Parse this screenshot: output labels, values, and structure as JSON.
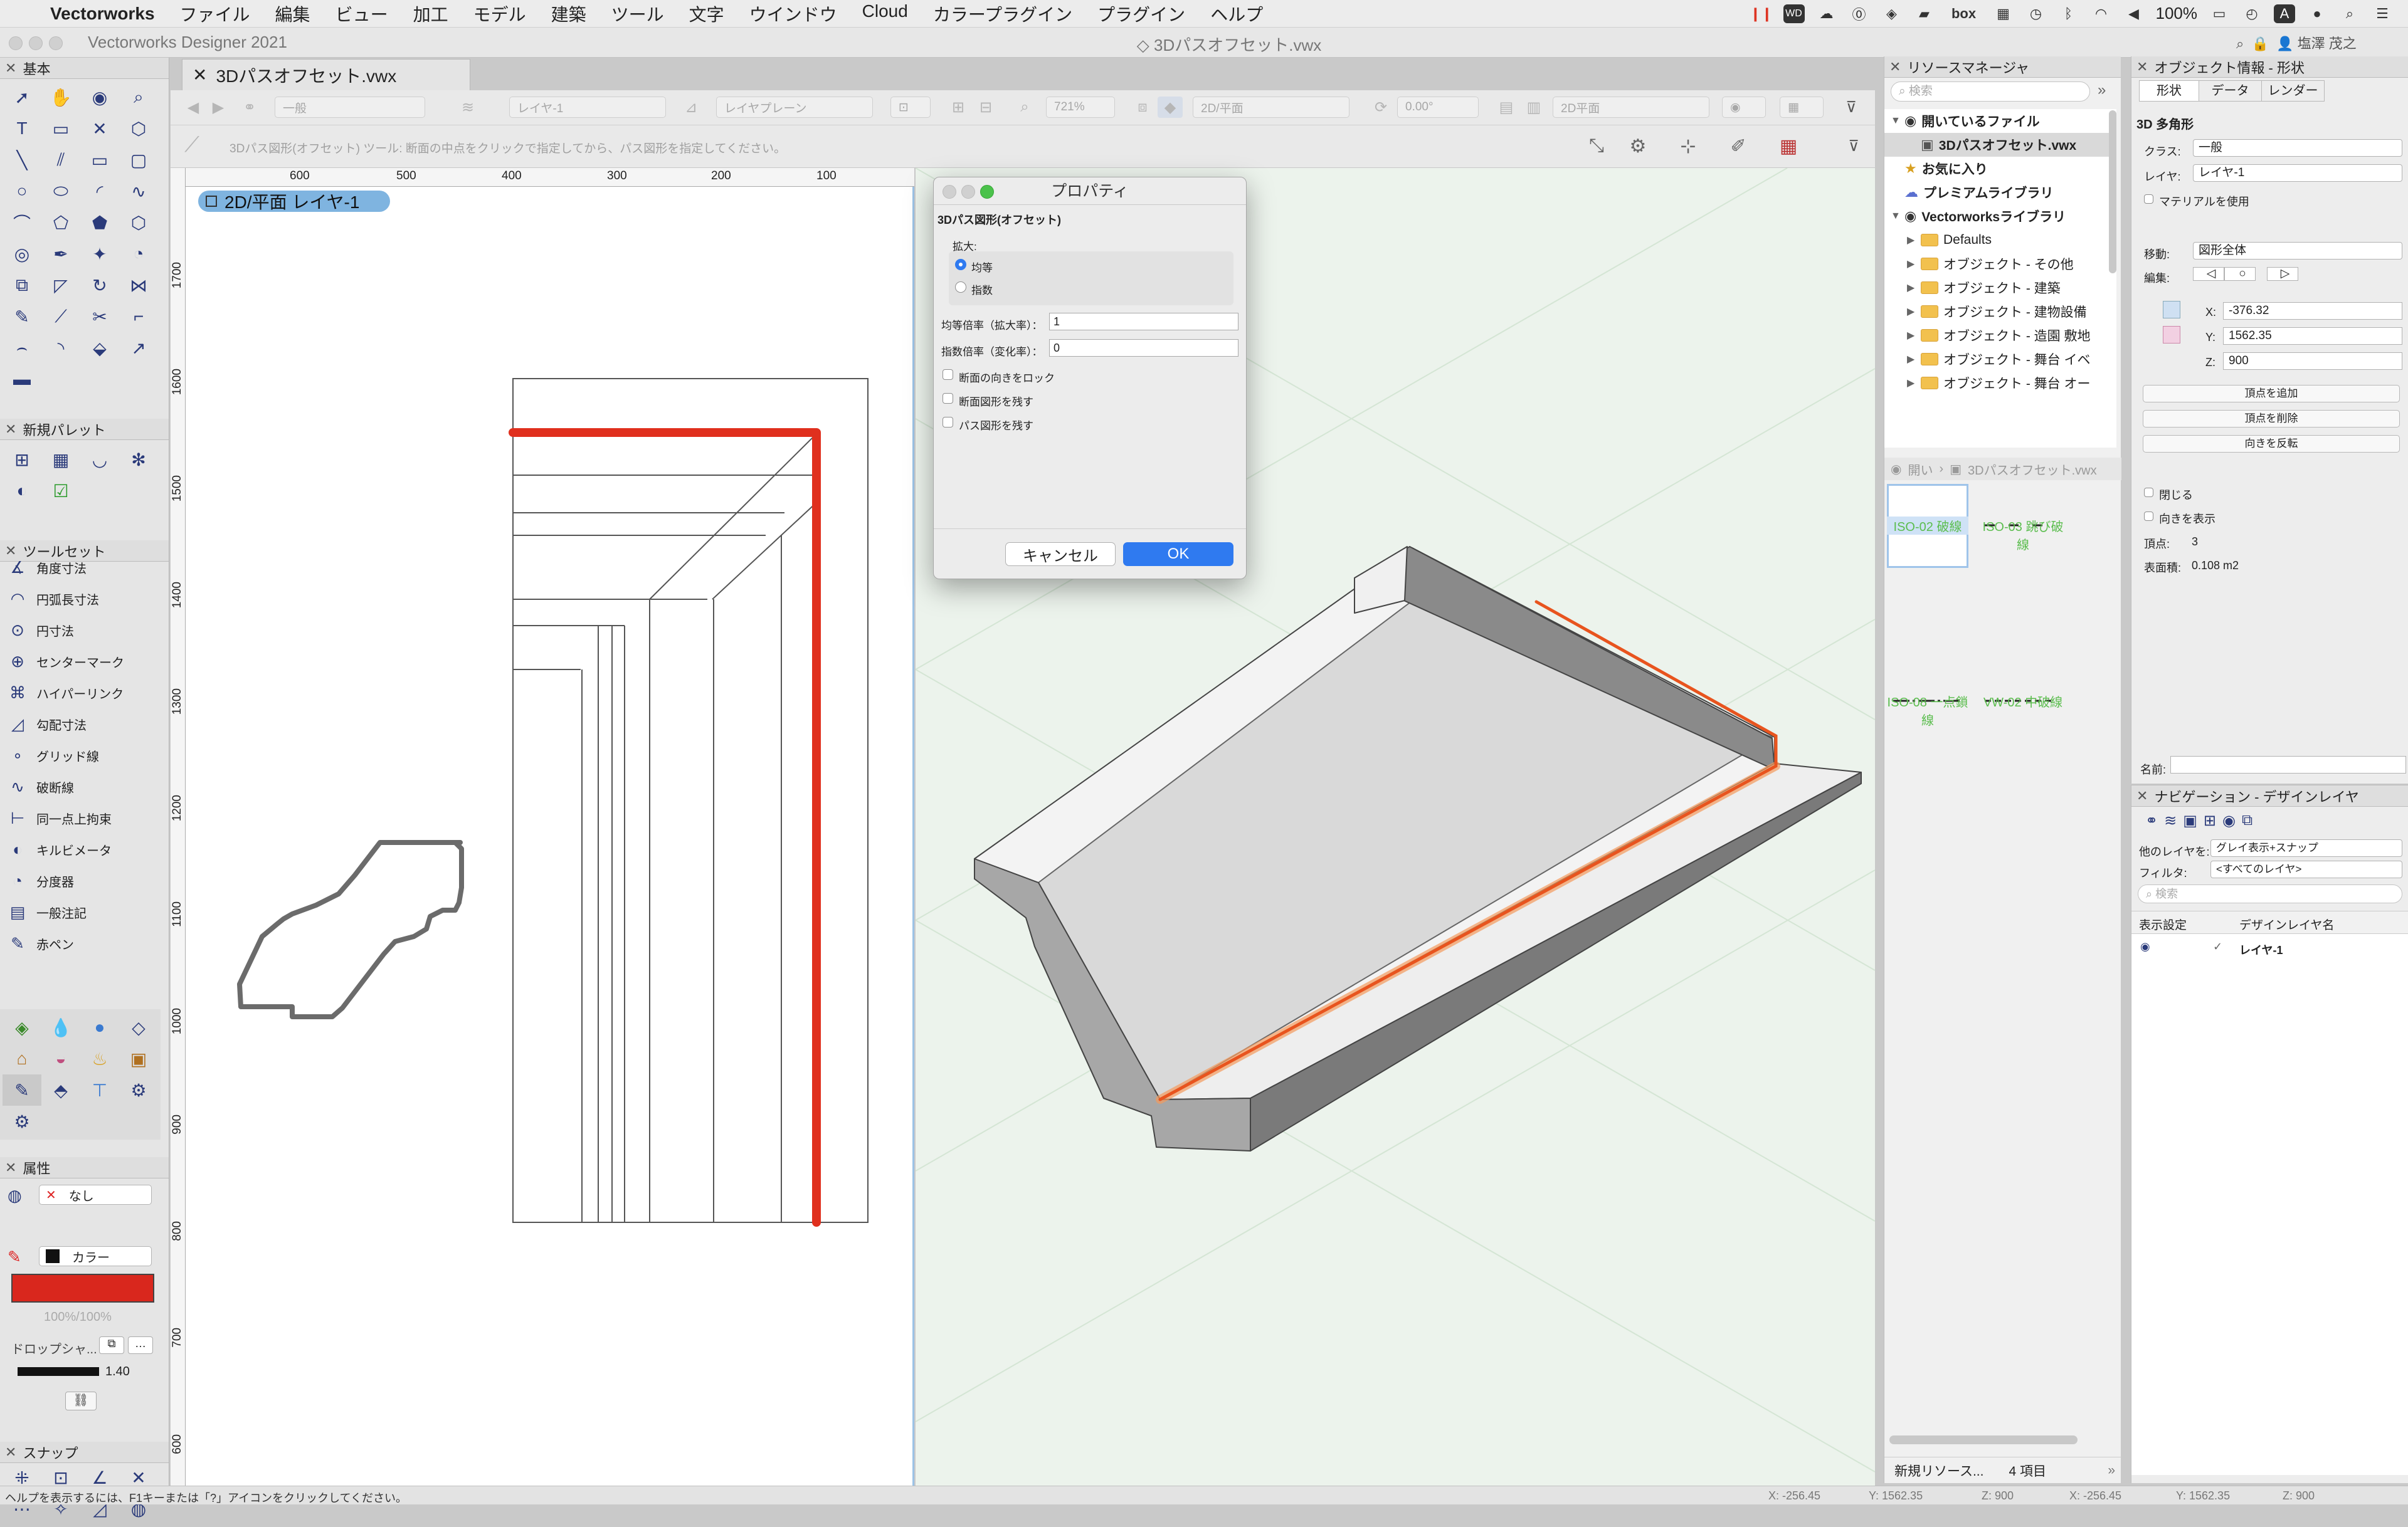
{
  "menubar": {
    "app": "Vectorworks",
    "items": [
      "ファイル",
      "編集",
      "ビュー",
      "加工",
      "モデル",
      "建築",
      "ツール",
      "文字",
      "ウインドウ",
      "Cloud",
      "カラープラグイン",
      "プラグイン",
      "ヘルプ"
    ],
    "battery": "100%",
    "user": "塩澤 茂之",
    "status_icons": [
      "parallels-icon",
      "wd-icon",
      "cloud-icon",
      "dropbox-icon",
      "messages-icon",
      "onepassword-icon",
      "box-icon",
      "calendar-icon",
      "timemachine-icon",
      "bluetooth-icon",
      "wifi-icon",
      "volume-icon",
      "battery-icon",
      "clock-icon",
      "user-icon",
      "spotlight-icon",
      "control-center-icon"
    ],
    "box_label": "box",
    "keyboard_label": "A"
  },
  "titlebar": {
    "app_name": "Vectorworks Designer 2021",
    "doc_title": "3Dパスオフセット.vwx"
  },
  "doc_tab": {
    "label": "3Dパスオフセット.vwx"
  },
  "toolbar": {
    "class_popup": "一般",
    "layer_popup": "レイヤ-1",
    "plane_popup": "レイヤプレーン",
    "zoom": "721%",
    "view_popup": "2D/平面",
    "rotation": "0.00°",
    "render_popup": "2D平面"
  },
  "hint": "3Dパス図形(オフセット) ツール: 断面の中点をクリックで指定してから、パス図形を指定してください。",
  "ruler": {
    "h_ticks": [
      "600",
      "500",
      "400",
      "300",
      "200",
      "100"
    ],
    "v_ticks": [
      "1700",
      "1600",
      "1500",
      "1400",
      "1300",
      "1200",
      "1100",
      "1000",
      "900",
      "800",
      "700",
      "600"
    ]
  },
  "layer_label": "2D/平面  レイヤ-1",
  "palettes": {
    "basic_title": "基本",
    "new_palette_title": "新規パレット",
    "toolset_title": "ツールセット",
    "toolset_items": [
      "角度寸法",
      "円弧長寸法",
      "円寸法",
      "センターマーク",
      "ハイパーリンク",
      "勾配寸法",
      "グリッド線",
      "破断線",
      "同一点上拘束",
      "キルビメータ",
      "分度器",
      "一般注記",
      "赤ペン"
    ],
    "attributes_title": "属性",
    "fill_value": "なし",
    "pen_value": "カラー",
    "opacity": "100%/100%",
    "drop_shadow": "ドロップシャ...",
    "line_weight": "1.40",
    "fill_color": "#d9271d",
    "snap_title": "スナップ"
  },
  "dialog": {
    "title": "プロパティ",
    "header": "3Dパス図形(オフセット)",
    "scale_label": "拡大:",
    "radio_uniform": "均等",
    "radio_exp": "指数",
    "uniform_label": "均等倍率（拡大率）：",
    "uniform_value": "1",
    "exp_label": "指数倍率（変化率）：",
    "exp_value": "0",
    "cb_lock": "断面の向きをロック",
    "cb_keep_section": "断面図形を残す",
    "cb_keep_path": "パス図形を残す",
    "cancel": "キャンセル",
    "ok": "OK"
  },
  "resource_manager": {
    "title": "リソースマネージャ",
    "search_placeholder": "検索",
    "tree": [
      {
        "label": "開いているファイル",
        "bold": true,
        "level": 0,
        "arrow": "▼",
        "kind": "vw"
      },
      {
        "label": "3Dパスオフセット.vwx",
        "bold": true,
        "level": 1,
        "arrow": "",
        "kind": "file"
      },
      {
        "label": "お気に入り",
        "bold": true,
        "level": 0,
        "arrow": "",
        "kind": "star"
      },
      {
        "label": "プレミアムライブラリ",
        "bold": true,
        "level": 0,
        "arrow": "",
        "kind": "cloud"
      },
      {
        "label": "Vectorworksライブラリ",
        "bold": true,
        "level": 0,
        "arrow": "▼",
        "kind": "vw"
      },
      {
        "label": "Defaults",
        "bold": false,
        "level": 1,
        "arrow": "▶",
        "kind": "folder"
      },
      {
        "label": "オブジェクト - その他",
        "bold": false,
        "level": 1,
        "arrow": "▶",
        "kind": "folder"
      },
      {
        "label": "オブジェクト - 建築",
        "bold": false,
        "level": 1,
        "arrow": "▶",
        "kind": "folder"
      },
      {
        "label": "オブジェクト - 建物設備",
        "bold": false,
        "level": 1,
        "arrow": "▶",
        "kind": "folder"
      },
      {
        "label": "オブジェクト - 造園 敷地",
        "bold": false,
        "level": 1,
        "arrow": "▶",
        "kind": "folder"
      },
      {
        "label": "オブジェクト - 舞台 イベ",
        "bold": false,
        "level": 1,
        "arrow": "▶",
        "kind": "folder"
      },
      {
        "label": "オブジェクト - 舞台 オー",
        "bold": false,
        "level": 1,
        "arrow": "▶",
        "kind": "folder"
      }
    ],
    "breadcrumb_short": "開い",
    "breadcrumb_file": "3Dパスオフセット.vwx",
    "resources": [
      "ISO-02 破線",
      "ISO-03 跳び破線",
      "ISO-08 一点鎖線",
      "VW-02 中破線"
    ],
    "new_resource": "新規リソース...",
    "count": "4 項目"
  },
  "object_info": {
    "title": "オブジェクト情報 - 形状",
    "tabs": [
      "形状",
      "データ",
      "レンダー"
    ],
    "object_type": "3D 多角形",
    "class_label": "クラス:",
    "class_value": "一般",
    "layer_label": "レイヤ:",
    "layer_value": "レイヤ-1",
    "material_label": "マテリアルを使用",
    "move_label": "移動:",
    "move_value": "図形全体",
    "edit_label": "編集:",
    "x_label": "X:",
    "x": "-376.32",
    "y_label": "Y:",
    "y": "1562.35",
    "z_label": "Z:",
    "z": "900",
    "btn_add": "頂点を追加",
    "btn_delete": "頂点を削除",
    "btn_reverse": "向きを反転",
    "closed": "閉じる",
    "show_dir": "向きを表示",
    "vertices_label": "頂点:",
    "vertices": "3",
    "area_label": "表面積:",
    "area": "0.108 m2",
    "name_label": "名前:"
  },
  "navigation": {
    "title": "ナビゲーション - デザインレイヤ",
    "other_layers_label": "他のレイヤを:",
    "other_layers_value": "グレイ表示+スナップ",
    "filter_label": "フィルタ:",
    "filter_value": "<すべてのレイヤ>",
    "search_placeholder": "検索",
    "col_visibility": "表示設定",
    "col_name": "デザインレイヤ名",
    "layer_name": "レイヤ-1"
  },
  "statusbar": {
    "help": "ヘルプを表示するには、F1キーまたは「?」アイコンをクリックしてください。",
    "x1": "X: -256.45",
    "y1": "Y: 1562.35",
    "z1": "Z: 900",
    "x2": "X: -256.45",
    "y2": "Y: 1562.35",
    "z2": "Z: 900"
  },
  "colors": {
    "path_red": "#e0301e",
    "dialog_ok": "#2f7af0",
    "layer_pill": "#7fb4e0",
    "resource_text": "#5bbd4e"
  }
}
